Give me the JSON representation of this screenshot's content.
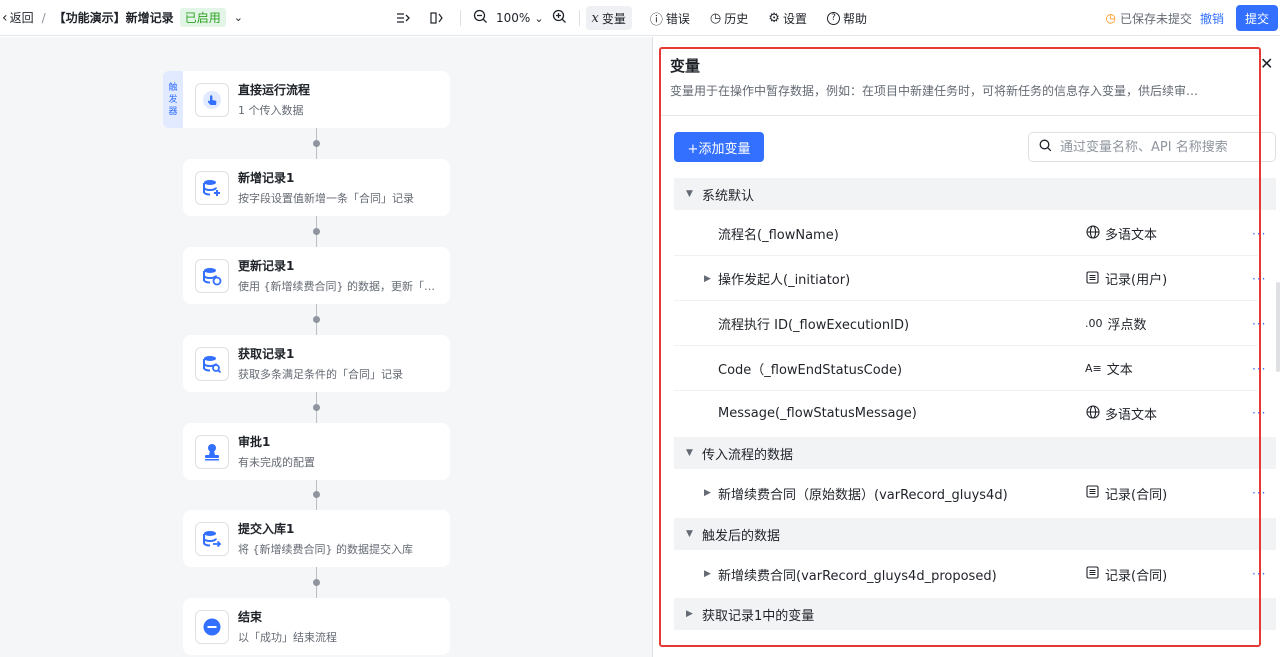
{
  "topbar": {
    "back_label": "返回",
    "separator": "/",
    "title": "【功能演示】新增记录",
    "status_badge": "已启用",
    "zoom": "100%",
    "tools": [
      {
        "icon": "𝑥",
        "label": "变量"
      },
      {
        "icon": "ⓘ",
        "label": "错误"
      },
      {
        "icon": "◷",
        "label": "历史"
      },
      {
        "icon": "⚙",
        "label": "设置"
      },
      {
        "icon": "?",
        "label": "帮助"
      }
    ],
    "saved_status": "已保存未提交",
    "undo_label": "撤销",
    "submit_label": "提交"
  },
  "canvas": {
    "trigger_tab": [
      "触",
      "发",
      "器"
    ],
    "nodes": [
      {
        "title": "直接运行流程",
        "desc": "1 个传入数据",
        "icon": "hand-pointer-icon"
      },
      {
        "title": "新增记录1",
        "desc": "按字段设置值新增一条「合同」记录",
        "icon": "database-add-icon"
      },
      {
        "title": "更新记录1",
        "desc": "使用 {新增续费合同} 的数据，更新「合同」记录",
        "icon": "database-refresh-icon"
      },
      {
        "title": "获取记录1",
        "desc": "获取多条满足条件的「合同」记录",
        "icon": "database-search-icon"
      },
      {
        "title": "审批1",
        "desc": "有未完成的配置",
        "icon": "approval-stamp-icon"
      },
      {
        "title": "提交入库1",
        "desc": "将 {新增续费合同} 的数据提交入库",
        "icon": "database-submit-icon"
      },
      {
        "title": "结束",
        "desc": "以「成功」结束流程",
        "icon": "end-minus-icon"
      }
    ]
  },
  "panel": {
    "title": "变量",
    "description": "变量用于在操作中暂存数据，例如：在项目中新建任务时，可将新任务的信息存入变量，供后续审…",
    "add_button": "+添加变量",
    "search_placeholder": "通过变量名称、API 名称搜索",
    "groups": [
      {
        "label": "系统默认",
        "expanded": true,
        "rows": [
          {
            "name": "流程名(_flowName)",
            "type": "多语文本",
            "type_icon": "globe-icon",
            "expandable": false
          },
          {
            "name": "操作发起人(_initiator)",
            "type": "记录(用户)",
            "type_icon": "record-icon",
            "expandable": true
          },
          {
            "name": "流程执行 ID(_flowExecutionID)",
            "type": "浮点数",
            "type_icon": "float-icon",
            "expandable": false
          },
          {
            "name": "Code（_flowEndStatusCode)",
            "type": "文本",
            "type_icon": "text-icon",
            "expandable": false
          },
          {
            "name": "Message(_flowStatusMessage)",
            "type": "多语文本",
            "type_icon": "globe-icon",
            "expandable": false
          }
        ]
      },
      {
        "label": "传入流程的数据",
        "expanded": true,
        "rows": [
          {
            "name": "新增续费合同（原始数据）(varRecord_gluys4d)",
            "type": "记录(合同)",
            "type_icon": "record-icon",
            "expandable": true
          }
        ]
      },
      {
        "label": "触发后的数据",
        "expanded": true,
        "rows": [
          {
            "name": "新增续费合同(varRecord_gluys4d_proposed)",
            "type": "记录(合同)",
            "type_icon": "record-icon",
            "expandable": true
          }
        ]
      },
      {
        "label": "获取记录1中的变量",
        "expanded": false,
        "rows": []
      }
    ],
    "type_glyphs": {
      "globe-icon": "🌐",
      "record-icon": "▤",
      "float-icon": ".00",
      "text-icon": "A≡"
    },
    "more_glyph": "···"
  },
  "colors": {
    "accent": "#3370ff",
    "enabled_bg": "#e3f5e6",
    "enabled_fg": "#2ea121",
    "highlight": "#e53935"
  }
}
